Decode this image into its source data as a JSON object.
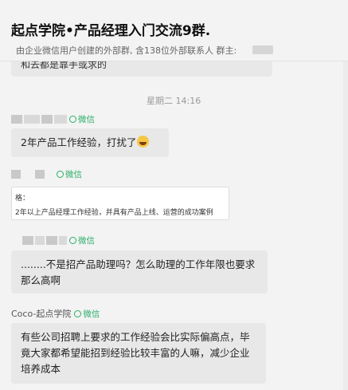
{
  "header": {
    "title": "起点学院•产品经理入门交流9群.",
    "subtitle": "由企业微信用户创建的外部群, 含138位外部联系人 群主:"
  },
  "messages": {
    "partial_top": "和去都是靠手或求的",
    "timestamp": "星期二 14:16",
    "wechat_tag": "微信",
    "msg1": {
      "text": "2年产品工作经验，打扰了"
    },
    "card": {
      "line1": "格：",
      "line2": "2年以上产品经理工作经验，并具有产品上线、运营的成功案例"
    },
    "msg3": {
      "text": "........不是招产品助理吗？怎么助理的工作年限也要求那么高啊"
    },
    "msg4": {
      "sender": "Coco-起点学院",
      "text": "有些公司招聘上要求的工作经验会比实际偏高点，毕竟大家都希望能招到经验比较丰富的人嘛，减少企业培养成本"
    }
  },
  "icons": [
    "wechat-icon",
    "grin-sweat-emoji-icon"
  ],
  "colors": {
    "wechat_green": "#2aae67",
    "bubble": "#e8e8e8",
    "background": "#f3f3f3"
  }
}
